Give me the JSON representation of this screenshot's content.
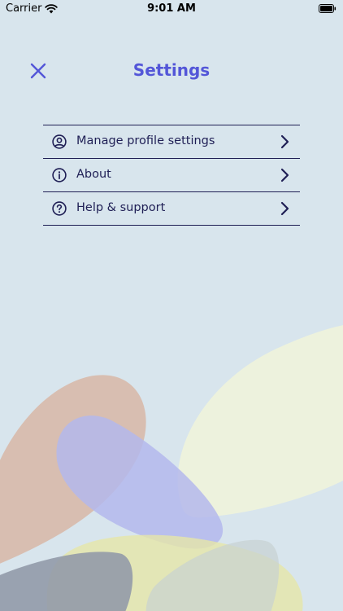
{
  "status_bar": {
    "carrier": "Carrier",
    "time": "9:01 AM"
  },
  "nav": {
    "title": "Settings"
  },
  "menu": {
    "items": [
      {
        "label": "Manage profile settings",
        "icon": "profile-icon"
      },
      {
        "label": "About",
        "icon": "info-icon"
      },
      {
        "label": "Help & support",
        "icon": "help-icon"
      }
    ]
  },
  "colors": {
    "background": "#d8e5ed",
    "accent": "#5356d8",
    "text": "#1f1f55"
  }
}
